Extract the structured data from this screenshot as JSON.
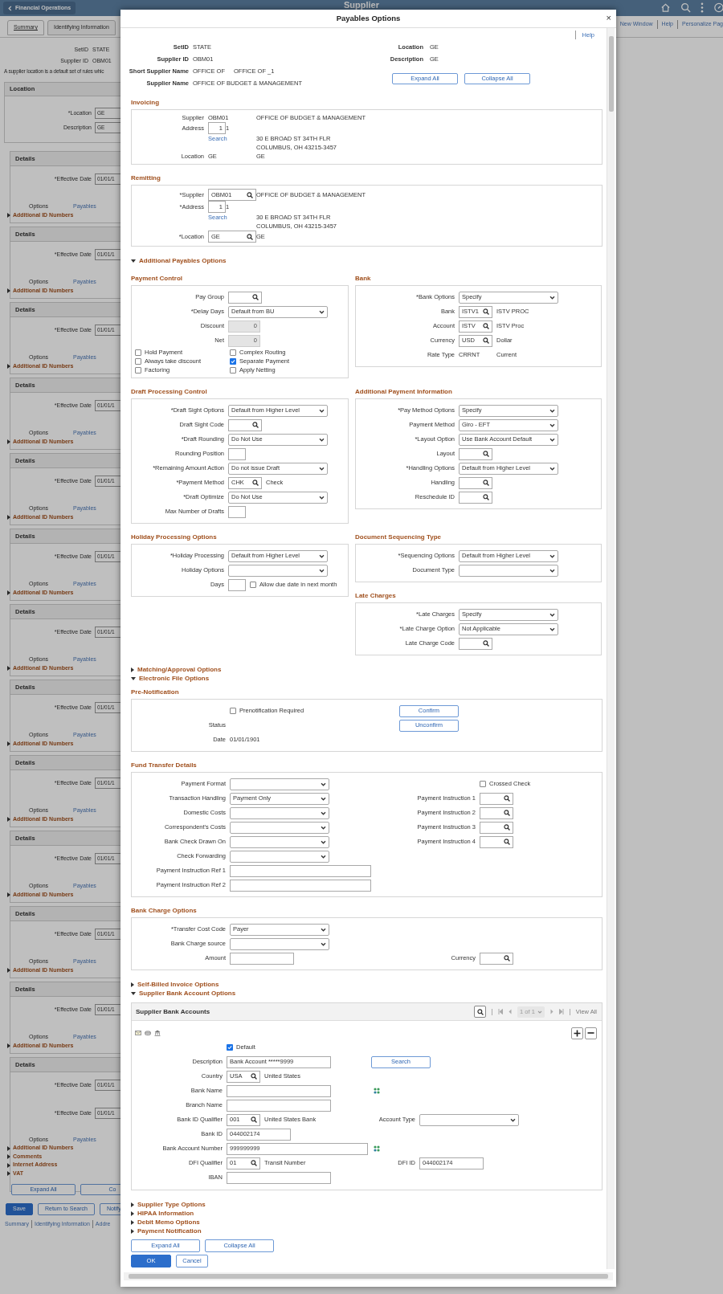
{
  "background": {
    "back_button": "Financial Operations",
    "title": "Supplier",
    "links": [
      "New Window",
      "Help",
      "Personalize Pag"
    ],
    "tabs": [
      {
        "label": "Summary",
        "selected": true
      },
      {
        "label": "Identifying Information",
        "selected": false
      }
    ],
    "summary": [
      {
        "label": "SetID",
        "value": "STATE"
      },
      {
        "label": "Supplier ID",
        "value": "OBM01"
      }
    ],
    "note": "A supplier location is a default set of rules whic",
    "location": {
      "title": "Location",
      "fields": [
        {
          "label": "*Location",
          "value": "GE"
        },
        {
          "label": "Description",
          "value": "GE"
        }
      ]
    },
    "details": [
      {
        "title": "Details",
        "dates": [
          {
            "label": "*Effective Date",
            "value": "01/01/1"
          }
        ],
        "options_label": "Options",
        "options_link": "Payables",
        "sections": [
          "Additional ID Numbers"
        ]
      },
      {
        "title": "Details",
        "dates": [
          {
            "label": "*Effective Date",
            "value": "01/01/1"
          }
        ],
        "options_label": "Options",
        "options_link": "Payables",
        "sections": [
          "Additional ID Numbers"
        ]
      },
      {
        "title": "Details",
        "dates": [
          {
            "label": "*Effective Date",
            "value": "01/01/1"
          }
        ],
        "options_label": "Options",
        "options_link": "Payables",
        "sections": [
          "Additional ID Numbers"
        ]
      },
      {
        "title": "Details",
        "dates": [
          {
            "label": "*Effective Date",
            "value": "01/01/1"
          }
        ],
        "options_label": "Options",
        "options_link": "Payables",
        "sections": [
          "Additional ID Numbers"
        ]
      },
      {
        "title": "Details",
        "dates": [
          {
            "label": "*Effective Date",
            "value": "01/01/1"
          }
        ],
        "options_label": "Options",
        "options_link": "Payables",
        "sections": [
          "Additional ID Numbers"
        ]
      },
      {
        "title": "Details",
        "dates": [
          {
            "label": "*Effective Date",
            "value": "01/01/1"
          }
        ],
        "options_label": "Options",
        "options_link": "Payables",
        "sections": [
          "Additional ID Numbers"
        ]
      },
      {
        "title": "Details",
        "dates": [
          {
            "label": "*Effective Date",
            "value": "01/01/1"
          }
        ],
        "options_label": "Options",
        "options_link": "Payables",
        "sections": [
          "Additional ID Numbers"
        ]
      },
      {
        "title": "Details",
        "dates": [
          {
            "label": "*Effective Date",
            "value": "01/01/1"
          }
        ],
        "options_label": "Options",
        "options_link": "Payables",
        "sections": [
          "Additional ID Numbers"
        ]
      },
      {
        "title": "Details",
        "dates": [
          {
            "label": "*Effective Date",
            "value": "01/01/1"
          }
        ],
        "options_label": "Options",
        "options_link": "Payables",
        "sections": [
          "Additional ID Numbers"
        ]
      },
      {
        "title": "Details",
        "dates": [
          {
            "label": "*Effective Date",
            "value": "01/01/1"
          }
        ],
        "options_label": "Options",
        "options_link": "Payables",
        "sections": [
          "Additional ID Numbers"
        ]
      },
      {
        "title": "Details",
        "dates": [
          {
            "label": "*Effective Date",
            "value": "01/01/1"
          }
        ],
        "options_label": "Options",
        "options_link": "Payables",
        "sections": [
          "Additional ID Numbers"
        ]
      },
      {
        "title": "Details",
        "dates": [
          {
            "label": "*Effective Date",
            "value": "01/01/1"
          }
        ],
        "options_label": "Options",
        "options_link": "Payables",
        "sections": [
          "Additional ID Numbers"
        ]
      },
      {
        "title": "Details",
        "dates": [
          {
            "label": "*Effective Date",
            "value": "01/01/1"
          },
          {
            "label": "*Effective Date",
            "value": "01/01/1"
          }
        ],
        "options_label": "Options",
        "options_link": "Payables",
        "sections": [
          "Additional ID Numbers",
          "Comments",
          "Internet Address",
          "VAT"
        ]
      }
    ],
    "expand_buttons": [
      "Expand All",
      "Co"
    ],
    "actions": [
      {
        "label": "Save",
        "kind": "primary"
      },
      {
        "label": "Return to Search",
        "kind": "secondary"
      },
      {
        "label": "Notify",
        "kind": "secondary"
      }
    ],
    "footer_links": [
      "Summary",
      "Identifying Information",
      "Addre"
    ]
  },
  "modal": {
    "title": "Payables Options",
    "close": "×",
    "help": "Help",
    "header_left": [
      {
        "label": "SetID",
        "value": "STATE"
      },
      {
        "label": "Supplier ID",
        "value": "OBM01"
      },
      {
        "label": "Short Supplier Name",
        "value": "OFFICE OF",
        "value2": "OFFICE OF _1"
      },
      {
        "label": "Supplier Name",
        "value": "OFFICE OF BUDGET & MANAGEMENT"
      }
    ],
    "header_right": [
      {
        "label": "Location",
        "value": "GE"
      },
      {
        "label": "Description",
        "value": "GE"
      }
    ],
    "header_buttons": [
      "Expand All",
      "Collapse All"
    ],
    "blocks": [
      {
        "kind": "address",
        "title": "Invoicing",
        "fields": [
          {
            "label": "Supplier",
            "kind": "text",
            "value": "OBM01",
            "desc": "OFFICE OF BUDGET & MANAGEMENT"
          },
          {
            "label": "Address",
            "kind": "small",
            "value": "1",
            "desc": "1"
          },
          {
            "kind": "link",
            "value": "Search",
            "desc": "30 E BROAD ST 34TH FLR"
          },
          {
            "desc": "COLUMBUS, OH  43215-3457"
          },
          {
            "label": "Location",
            "kind": "text",
            "value": "GE",
            "desc": "GE"
          }
        ]
      },
      {
        "kind": "address",
        "title": "Remitting",
        "fields": [
          {
            "label": "*Supplier",
            "kind": "lookup",
            "value": "OBM01",
            "desc": "OFFICE OF BUDGET & MANAGEMENT"
          },
          {
            "label": "*Address",
            "kind": "small",
            "value": "1",
            "desc": "1"
          },
          {
            "kind": "link",
            "value": "Search",
            "desc": "30 E BROAD ST 34TH FLR"
          },
          {
            "desc": "COLUMBUS, OH  43215-3457"
          },
          {
            "label": "*Location",
            "kind": "lookup",
            "value": "GE",
            "desc": "GE"
          }
        ]
      },
      {
        "kind": "toggle",
        "label": "Additional Payables Options",
        "expanded": true
      },
      {
        "kind": "pair",
        "columns": [
          [
            {
              "kind": "form",
              "title": "Payment Control",
              "fields": [
                {
                  "label": "Pay Group",
                  "kind": "lookup"
                },
                {
                  "label": "*Delay Days",
                  "kind": "select",
                  "value": "Default from BU"
                },
                {
                  "label": "Discount",
                  "kind": "amount",
                  "value": "0",
                  "disabled": true
                },
                {
                  "label": "Net",
                  "kind": "amount",
                  "value": "0",
                  "disabled": true
                }
              ],
              "checks": [
                {
                  "text": "Hold Payment",
                  "checked": false
                },
                {
                  "text": "Complex Routing",
                  "checked": false
                },
                {
                  "text": "Always take discount",
                  "checked": false
                },
                {
                  "text": "Separate Payment",
                  "checked": true
                },
                {
                  "text": "Factoring",
                  "checked": false
                },
                {
                  "text": "Apply Netting",
                  "checked": false
                }
              ]
            }
          ],
          [
            {
              "kind": "form",
              "title": "Bank",
              "fields": [
                {
                  "label": "*Bank Options",
                  "kind": "select",
                  "value": "Specify"
                },
                {
                  "label": "Bank",
                  "kind": "lookup",
                  "value": "ISTV1",
                  "desc": "ISTV PROC"
                },
                {
                  "label": "Account",
                  "kind": "lookup",
                  "value": "ISTV",
                  "desc": "ISTV Proc"
                },
                {
                  "label": "Currency",
                  "kind": "lookup",
                  "value": "USD",
                  "desc": "Dollar"
                },
                {
                  "label": "Rate Type",
                  "kind": "text",
                  "value": "CRRNT",
                  "desc": "Current"
                }
              ]
            }
          ]
        ]
      },
      {
        "kind": "pair",
        "columns": [
          [
            {
              "kind": "form",
              "title": "Draft Processing Control",
              "fields": [
                {
                  "label": "*Draft Sight Options",
                  "kind": "select",
                  "value": "Default from Higher Level"
                },
                {
                  "label": "Draft Sight Code",
                  "kind": "lookup"
                },
                {
                  "label": "*Draft Rounding",
                  "kind": "select",
                  "value": "Do Not Use"
                },
                {
                  "label": "Rounding Position",
                  "kind": "small"
                },
                {
                  "label": "*Remaining Amount Action",
                  "kind": "select",
                  "value": "Do not issue Draft"
                },
                {
                  "label": "*Payment Method",
                  "kind": "lookup",
                  "value": "CHK",
                  "desc": "Check"
                },
                {
                  "label": "*Draft Optimize",
                  "kind": "select",
                  "value": "Do Not Use"
                },
                {
                  "label": "Max Number of Drafts",
                  "kind": "small"
                }
              ]
            }
          ],
          [
            {
              "kind": "form",
              "title": "Additional Payment Information",
              "fields": [
                {
                  "label": "*Pay Method Options",
                  "kind": "select",
                  "value": "Specify"
                },
                {
                  "label": "Payment Method",
                  "kind": "select",
                  "value": "Giro - EFT"
                },
                {
                  "label": "*Layout Option",
                  "kind": "select",
                  "value": "Use Bank Account Default"
                },
                {
                  "label": "Layout",
                  "kind": "lookup"
                },
                {
                  "label": "*Handling Options",
                  "kind": "select",
                  "value": "Default from Higher Level"
                },
                {
                  "label": "Handling",
                  "kind": "lookup"
                },
                {
                  "label": "Reschedule ID",
                  "kind": "lookup"
                }
              ]
            }
          ]
        ]
      },
      {
        "kind": "pair",
        "columns": [
          [
            {
              "kind": "form",
              "title": "Holiday Processing Options",
              "fields": [
                {
                  "label": "*Holiday Processing",
                  "kind": "select",
                  "value": "Default from Higher Level"
                },
                {
                  "label": "Holiday Options",
                  "kind": "select"
                },
                {
                  "label": "Days",
                  "kind": "small",
                  "check": {
                    "text": "Allow due date in next month",
                    "checked": false
                  }
                }
              ]
            }
          ],
          [
            {
              "kind": "form",
              "title": "Document Sequencing Type",
              "fields": [
                {
                  "label": "*Sequencing Options",
                  "kind": "select",
                  "value": "Default from Higher Level"
                },
                {
                  "label": "Document Type",
                  "kind": "select"
                }
              ]
            },
            {
              "kind": "form",
              "title": "Late Charges",
              "fields": [
                {
                  "label": "*Late Charges",
                  "kind": "select",
                  "value": "Specify"
                },
                {
                  "label": "*Late Charge Option",
                  "kind": "select",
                  "value": "Not Applicable"
                },
                {
                  "label": "Late Charge Code",
                  "kind": "lookup"
                }
              ]
            }
          ]
        ]
      },
      {
        "kind": "toggle",
        "label": "Matching/Approval Options",
        "expanded": false
      },
      {
        "kind": "toggle",
        "label": "Electronic File Options",
        "expanded": true
      },
      {
        "kind": "form",
        "title": "Pre-Notification",
        "fields": [
          {
            "kind": "checkbox",
            "text": "Prenotification Required",
            "checked": false,
            "side": {
              "kind": "button",
              "value": "Confirm"
            }
          },
          {
            "label": "Status",
            "side": {
              "kind": "button",
              "value": "Unconfirm"
            }
          },
          {
            "label": "Date",
            "kind": "text",
            "value": "01/01/1901"
          }
        ]
      },
      {
        "kind": "form",
        "title": "Fund Transfer Details",
        "fields": [
          {
            "label": "Payment Format",
            "kind": "select",
            "side": {
              "kind": "checkbox",
              "text": "Crossed Check",
              "checked": false
            }
          },
          {
            "label": "Transaction Handling",
            "kind": "select",
            "value": "Payment Only",
            "side": {
              "label": "Payment Instruction 1",
              "kind": "lookup"
            }
          },
          {
            "label": "Domestic Costs",
            "kind": "select",
            "side": {
              "label": "Payment Instruction 2",
              "kind": "lookup"
            }
          },
          {
            "label": "Correspondent's Costs",
            "kind": "select",
            "side": {
              "label": "Payment Instruction 3",
              "kind": "lookup"
            }
          },
          {
            "label": "Bank Check Drawn On",
            "kind": "select",
            "side": {
              "label": "Payment Instruction 4",
              "kind": "lookup"
            }
          },
          {
            "label": "Check Forwarding",
            "kind": "select"
          },
          {
            "label": "Payment Instruction Ref 1",
            "kind": "wide_input"
          },
          {
            "label": "Payment Instruction Ref 2",
            "kind": "wide_input"
          }
        ]
      },
      {
        "kind": "form",
        "title": "Bank Charge Options",
        "fields": [
          {
            "label": "*Transfer Cost Code",
            "kind": "select",
            "value": "Payer"
          },
          {
            "label": "Bank Charge source",
            "kind": "select"
          },
          {
            "label": "Amount",
            "kind": "short_input",
            "side": {
              "label": "Currency",
              "kind": "lookup"
            }
          }
        ]
      },
      {
        "kind": "toggle",
        "label": "Self-Billed Invoice Options",
        "expanded": false
      },
      {
        "kind": "toggle",
        "label": "Supplier Bank Account Options",
        "expanded": true
      },
      {
        "kind": "account",
        "title": "Supplier Bank Accounts",
        "pager": "1 of 1",
        "view_all": "View All",
        "fields": [
          {
            "kind": "checkbox",
            "text": "Default",
            "checked": true
          },
          {
            "label": "Description",
            "kind": "input",
            "value": "Bank Account *****9999",
            "side": {
              "kind": "button",
              "value": "Search"
            }
          },
          {
            "label": "Country",
            "kind": "lookup",
            "value": "USA",
            "desc": "United States"
          },
          {
            "label": "Bank Name",
            "kind": "input",
            "side": {
              "kind": "icon"
            }
          },
          {
            "label": "Branch Name",
            "kind": "input"
          },
          {
            "label": "Bank ID Qualifier",
            "kind": "lookup",
            "value": "001",
            "desc": "United States Bank",
            "side": {
              "label": "Account Type",
              "kind": "select"
            }
          },
          {
            "label": "Bank ID",
            "kind": "short_input",
            "value": "044002174"
          },
          {
            "label": "Bank Account Number",
            "kind": "wide_input",
            "value": "999999999",
            "side": {
              "kind": "icon"
            }
          },
          {
            "label": "DFI Qualifier",
            "kind": "lookup",
            "value": "01",
            "desc": "Transit Number",
            "side": {
              "label": "DFI ID",
              "kind": "short_input",
              "value": "044002174"
            }
          },
          {
            "label": "IBAN",
            "kind": "input"
          }
        ]
      },
      {
        "kind": "toggle",
        "label": "Supplier Type Options",
        "expanded": false
      },
      {
        "kind": "toggle",
        "label": "HIPAA Information",
        "expanded": false
      },
      {
        "kind": "toggle",
        "label": "Debit Memo Options",
        "expanded": false
      },
      {
        "kind": "toggle",
        "label": "Payment Notification",
        "expanded": false
      },
      {
        "kind": "buttons",
        "items": [
          {
            "label": "Expand All",
            "kind": "secondary"
          },
          {
            "label": "Collapse All",
            "kind": "secondary"
          }
        ]
      },
      {
        "kind": "buttons",
        "items": [
          {
            "label": "OK",
            "kind": "primary"
          },
          {
            "label": "Cancel",
            "kind": "secondary"
          }
        ]
      }
    ]
  }
}
